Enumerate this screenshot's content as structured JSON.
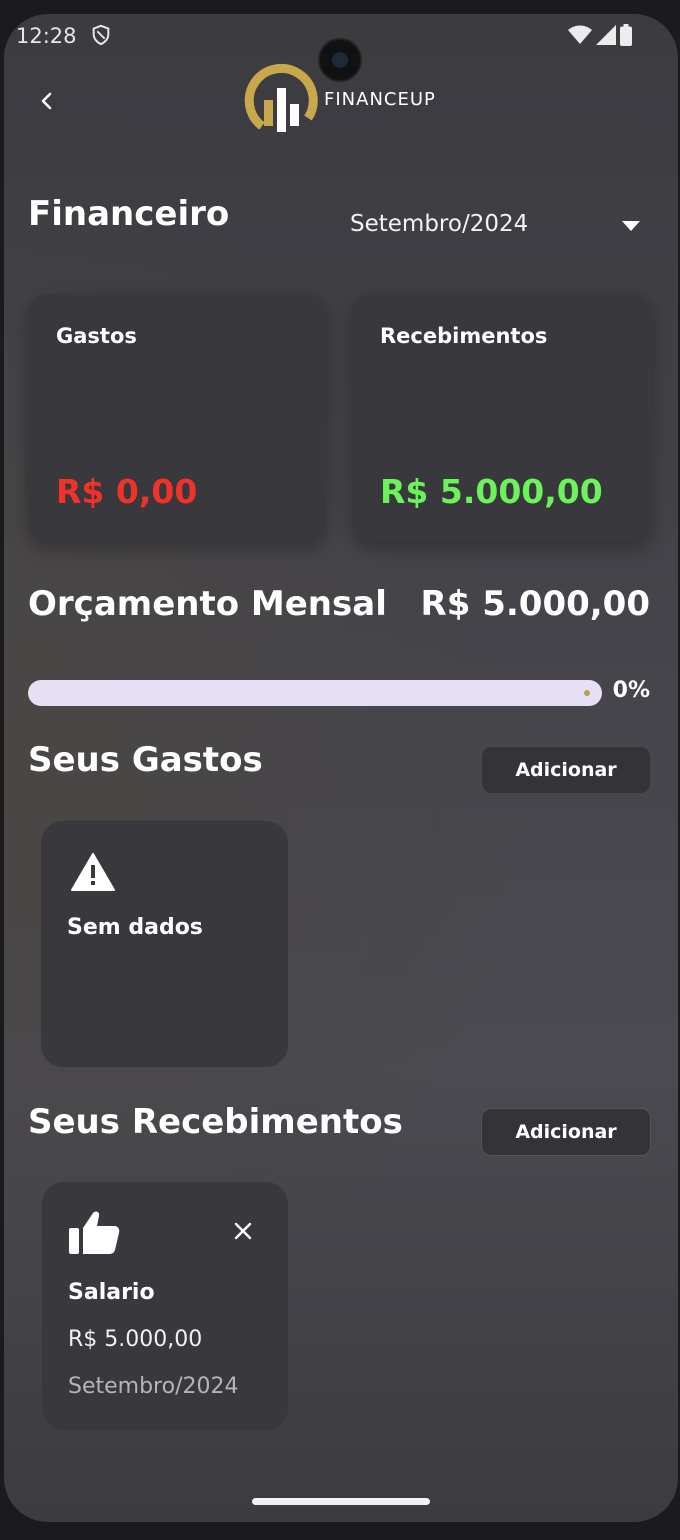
{
  "status_bar": {
    "time": "12:28"
  },
  "header": {
    "logo_text": "FINANCEUP"
  },
  "page": {
    "title": "Financeiro",
    "month_selected": "Setembro/2024"
  },
  "summary": {
    "gastos": {
      "label": "Gastos",
      "value": "R$ 0,00",
      "color": "#f0322b"
    },
    "recebimentos": {
      "label": "Recebimentos",
      "value": "R$ 5.000,00",
      "color": "#6cf25a"
    }
  },
  "budget": {
    "title": "Orçamento Mensal",
    "value": "R$ 5.000,00",
    "percent_label": "0%",
    "percent": 0
  },
  "gastos_section": {
    "title": "Seus Gastos",
    "add_label": "Adicionar",
    "empty_text": "Sem dados"
  },
  "recebimentos_section": {
    "title": "Seus Recebimentos",
    "add_label": "Adicionar",
    "items": [
      {
        "name": "Salario",
        "amount": "R$ 5.000,00",
        "date": "Setembro/2024"
      }
    ]
  },
  "colors": {
    "accent_gold": "#c9a84c",
    "progress_track": "#e6dff5"
  }
}
